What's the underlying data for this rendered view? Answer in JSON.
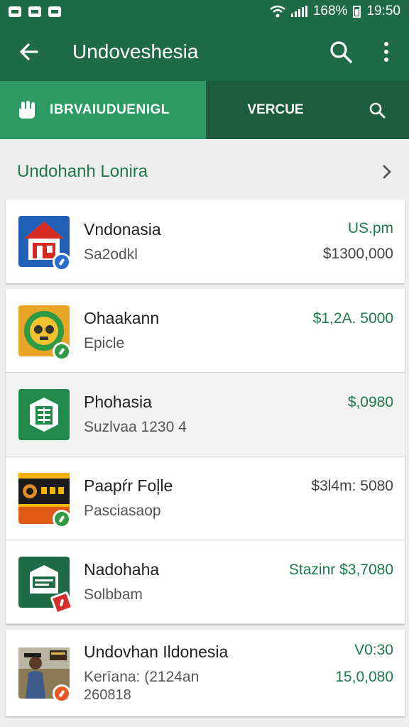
{
  "status_bar": {
    "battery": "168%",
    "time": "19:50"
  },
  "app_bar": {
    "title": "Undoveshesia"
  },
  "tabs": [
    {
      "label": "IBRVAIUDUENIGL"
    },
    {
      "label": "VERCUE"
    }
  ],
  "section": {
    "title": "Undohanh Lonira"
  },
  "items": [
    {
      "name": "Vndonasia",
      "sub": "Sa2odkl",
      "value1": "US.pm",
      "value2": "$1300,000"
    },
    {
      "name": "Ohaakann",
      "sub": "Epicle",
      "value1": "$1,2A. 5000",
      "value2": ""
    },
    {
      "name": "Phohasia",
      "sub": "Suzlvaa 1230 4",
      "value1": "$,0980",
      "value2": ""
    },
    {
      "name": "Paapŕr Foļle",
      "sub": "Pasciasaop",
      "value1": "$3l4m: 5080",
      "value2": ""
    },
    {
      "name": "Nadohaha",
      "sub": "Solbbam",
      "value1": "Stazinr $3,7080",
      "value2": ""
    },
    {
      "name": "Undovhan Ildonesia",
      "sub": "Kerīana: (2124an",
      "sub2": "260818",
      "value1": "V0:30",
      "value2": "15,0,080"
    }
  ],
  "colors": {
    "primary": "#1e6b46",
    "tab_active": "#2c9a62",
    "accent_text": "#1e7a4c"
  },
  "icons": [
    "back-arrow-icon",
    "search-icon",
    "more-vert-icon",
    "hand-icon",
    "chevron-right-icon"
  ]
}
